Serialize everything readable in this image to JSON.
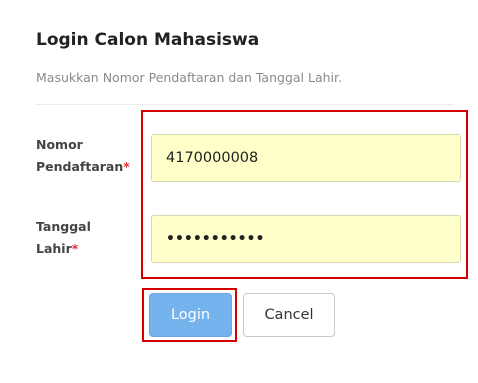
{
  "form": {
    "title": "Login Calon Mahasiswa",
    "subtitle": "Masukkan Nomor Pendaftaran dan Tanggal Lahir.",
    "fields": [
      {
        "label_line1": "Nomor",
        "label_line2": "Pendaftaran",
        "required_mark": "*",
        "value": "4170000008"
      },
      {
        "label_line1": "Tanggal",
        "label_line2": "Lahir",
        "required_mark": "*",
        "value": "•••••••••••"
      }
    ],
    "buttons": {
      "login_label": "Login",
      "cancel_label": "Cancel"
    }
  },
  "colors": {
    "input_background": "#ffffc9",
    "highlight_border": "#d40000",
    "primary_button": "#74b3ee",
    "required_mark": "#e0332f"
  }
}
